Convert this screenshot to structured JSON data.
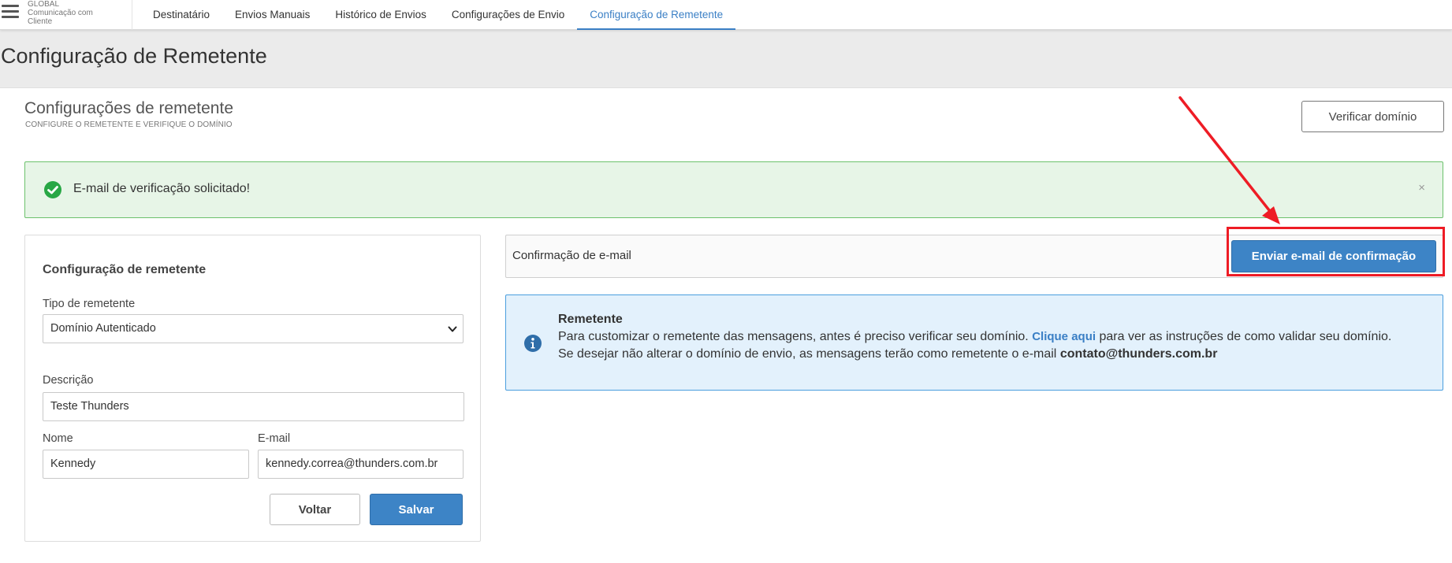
{
  "nav": {
    "brand_lines": [
      "GLOBAL",
      "Comunicação com",
      "Cliente"
    ],
    "tabs": [
      {
        "label": "Destinatário",
        "active": false
      },
      {
        "label": "Envios Manuais",
        "active": false
      },
      {
        "label": "Histórico de Envios",
        "active": false
      },
      {
        "label": "Configurações de Envio",
        "active": false
      },
      {
        "label": "Configuração de Remetente",
        "active": true
      }
    ]
  },
  "page": {
    "title": "Configuração de Remetente"
  },
  "section": {
    "title": "Configurações de remetente",
    "subtitle": "CONFIGURE O REMETENTE E VERIFIQUE O DOMÍNIO",
    "verify_button": "Verificar domínio"
  },
  "alert": {
    "message": "E-mail de verificação solicitado!",
    "close": "×",
    "color": "#6cc16c"
  },
  "form": {
    "title": "Configuração de remetente",
    "sender_type_label": "Tipo de remetente",
    "sender_type_value": "Domínio Autenticado",
    "description_label": "Descrição",
    "description_value": "Teste Thunders",
    "name_label": "Nome",
    "name_value": "Kennedy",
    "email_label": "E-mail",
    "email_value": "kennedy.correa@thunders.com.br",
    "back_button": "Voltar",
    "save_button": "Salvar"
  },
  "confirmation": {
    "label": "Confirmação de e-mail",
    "send_button": "Enviar e-mail de confirmação"
  },
  "info": {
    "title": "Remetente",
    "text_before_link": "Para customizar o remetente das mensagens, antes é preciso verificar seu domínio.",
    "link": "Clique aqui",
    "text_after_link": "para ver as instruções de como validar seu domínio. Se desejar não alterar o domínio de envio, as mensagens terão como remetente o e-mail",
    "default_email": "contato@thunders.com.br"
  },
  "colors": {
    "accent": "#3a7fc5",
    "primary_button": "#3d84c6",
    "annotation_red": "#ee1c25",
    "info_bg": "#e3f1fc",
    "success_bg": "#e7f5e7"
  }
}
